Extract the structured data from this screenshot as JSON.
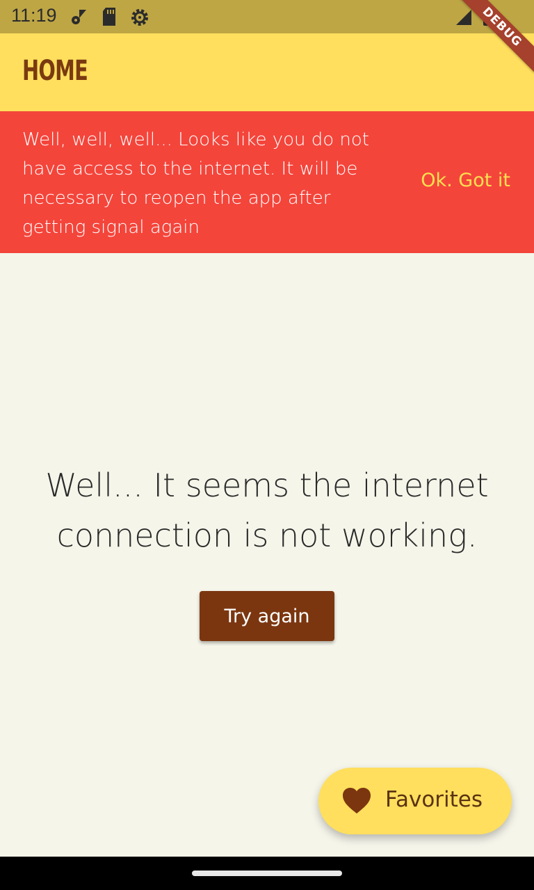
{
  "status_bar": {
    "time": "11:19",
    "icons": [
      "network-settings-icon",
      "sd-card-icon",
      "gear-icon",
      "signal-icon",
      "battery-icon"
    ]
  },
  "app_bar": {
    "title": "HOME"
  },
  "debug_ribbon": {
    "label": "DEBUG"
  },
  "banner": {
    "message": "Well, well, well... Looks like you do not have access to the internet. It will be necessary to reopen the app after getting signal again",
    "action_label": "Ok. Got it"
  },
  "main": {
    "message": "Well... It seems the internet connection is not working.",
    "retry_label": "Try again"
  },
  "fab": {
    "label": "Favorites",
    "icon": "heart-icon"
  },
  "colors": {
    "app_bar": "#ffdf5d",
    "status_bar": "#bea645",
    "banner": "#f4453b",
    "banner_action": "#ffe04f",
    "primary": "#7b3610",
    "background": "#f5f5ea"
  }
}
